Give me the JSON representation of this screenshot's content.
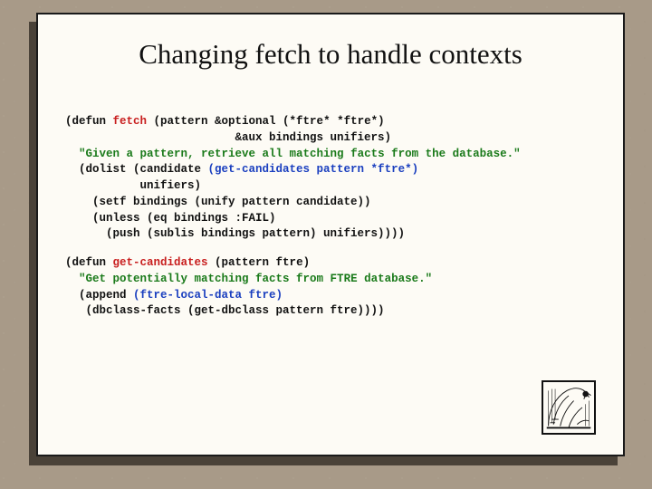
{
  "slide": {
    "title": "Changing fetch to handle contexts",
    "code1": {
      "l1a": "(defun ",
      "l1_fetch": "fetch",
      "l1b": " (pattern &optional (*ftre* *ftre*)",
      "l2": "                         &aux bindings unifiers)",
      "l3a": "  ",
      "l3_doc": "\"Given a pattern, retrieve all matching facts from the database.\"",
      "l4a": "  (dolist (candidate ",
      "l4_call": "(get-candidates pattern *ftre*)",
      "l5": "           unifiers)",
      "l6": "    (setf bindings (unify pattern candidate))",
      "l7": "    (unless (eq bindings :FAIL)",
      "l8": "      (push (sublis bindings pattern) unifiers))))"
    },
    "code2": {
      "l1a": "(defun ",
      "l1_name": "get-candidates",
      "l1b": " (pattern ftre)",
      "l2a": "  ",
      "l2_doc": "\"Get potentially matching facts from FTRE database.\"",
      "l3a": "  (append ",
      "l3_call": "(ftre-local-data ftre)",
      "l4": "   (dbclass-facts (get-dbclass pattern ftre))))"
    }
  }
}
